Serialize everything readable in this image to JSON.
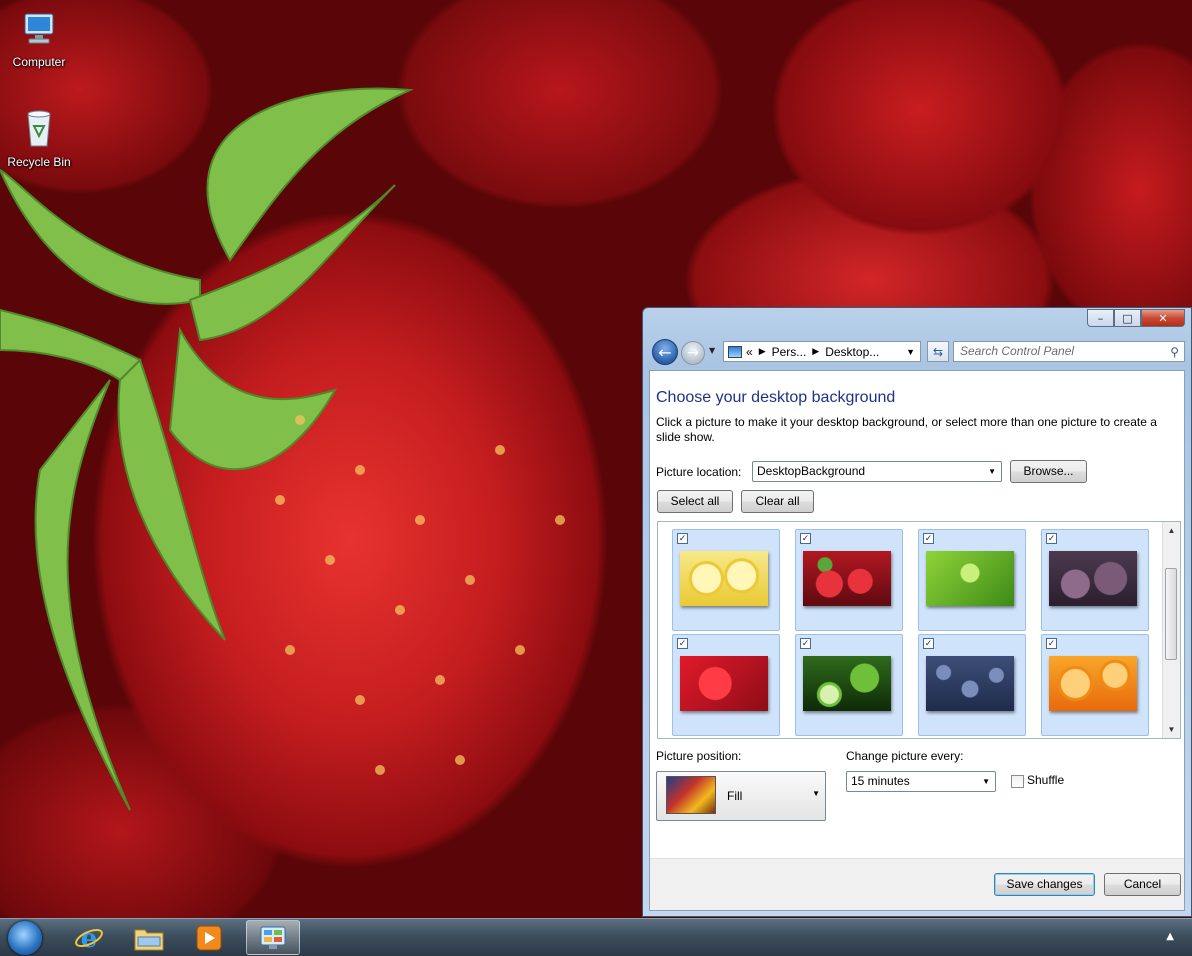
{
  "desktop": {
    "icons": [
      {
        "label": "Computer",
        "icon": "computer-icon"
      },
      {
        "label": "Recycle Bin",
        "icon": "recycle-bin-icon"
      }
    ]
  },
  "taskbar": {
    "items": [
      {
        "icon": "start-orb-icon"
      },
      {
        "icon": "internet-explorer-icon"
      },
      {
        "icon": "windows-explorer-icon"
      },
      {
        "icon": "media-player-icon"
      },
      {
        "icon": "control-panel-icon",
        "active": true
      }
    ],
    "tray_arrow": "▲"
  },
  "window": {
    "caption": {
      "minimize": "–",
      "maximize": "□",
      "close": "✕"
    },
    "nav": {
      "back": "←",
      "forward": "→",
      "breadcrumb_prefix": "«",
      "breadcrumb": [
        "Pers...",
        "Desktop..."
      ],
      "search_placeholder": "Search Control Panel"
    },
    "heading": "Choose your desktop background",
    "description": "Click a picture to make it your desktop background, or select more than one picture to create a slide show.",
    "picture_location_label": "Picture location:",
    "picture_location_value": "DesktopBackground",
    "browse_label": "Browse...",
    "select_all_label": "Select all",
    "clear_all_label": "Clear all",
    "pictures": [
      {
        "name": "lemons",
        "checked": true,
        "colors": [
          "#f7e98a",
          "#e9c934"
        ]
      },
      {
        "name": "strawberries",
        "checked": true,
        "colors": [
          "#d82430",
          "#7d0c12"
        ]
      },
      {
        "name": "star-fruit",
        "checked": true,
        "colors": [
          "#8fd43a",
          "#3d8a17"
        ]
      },
      {
        "name": "figs",
        "checked": true,
        "colors": [
          "#7b5a78",
          "#3b2b3f"
        ]
      },
      {
        "name": "raspberries",
        "checked": true,
        "colors": [
          "#e11a2a",
          "#8f0c18"
        ]
      },
      {
        "name": "limes",
        "checked": true,
        "colors": [
          "#6ebf3a",
          "#1d4f12"
        ]
      },
      {
        "name": "blueberries",
        "checked": true,
        "colors": [
          "#5c6f9a",
          "#1f2b4b"
        ]
      },
      {
        "name": "oranges",
        "checked": true,
        "colors": [
          "#f8a62a",
          "#e86a0c"
        ]
      }
    ],
    "picture_position_label": "Picture position:",
    "picture_position_value": "Fill",
    "change_every_label": "Change picture every:",
    "change_every_value": "15 minutes",
    "shuffle_label": "Shuffle",
    "save_label": "Save changes",
    "cancel_label": "Cancel"
  }
}
